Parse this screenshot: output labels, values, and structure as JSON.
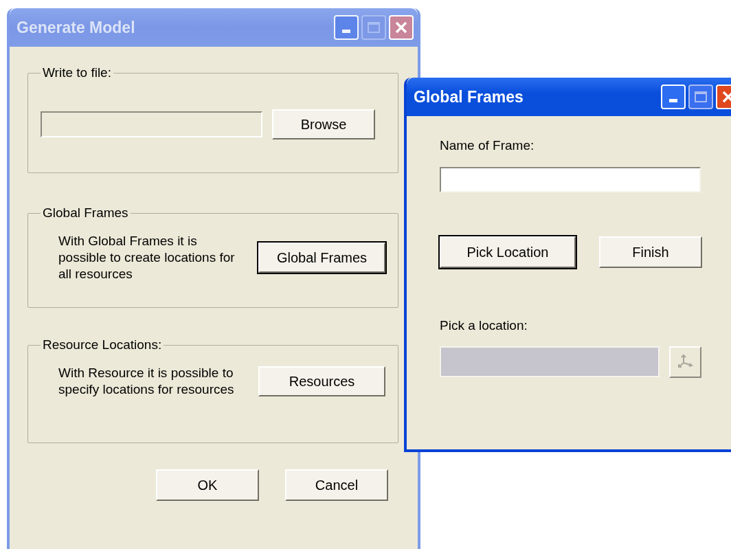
{
  "windows": [
    {
      "title": "Generate Model",
      "active": false,
      "groups": [
        {
          "kind": "file",
          "label": "Write to file:",
          "button": {
            "label": "Browse",
            "default": false
          }
        },
        {
          "kind": "action",
          "label": "Global Frames",
          "description": "With Global Frames it is possible to create locations for all resources",
          "button": {
            "label": "Global Frames",
            "default": true
          }
        },
        {
          "kind": "action",
          "label": "Resource Locations:",
          "description": "With Resource it is possible to specify locations for resources",
          "button": {
            "label": "Resources",
            "default": false
          }
        }
      ],
      "buttons": [
        {
          "label": "OK",
          "default": false
        },
        {
          "label": "Cancel",
          "default": false
        }
      ]
    },
    {
      "title": "Global Frames",
      "active": true,
      "name_label": "Name of Frame:",
      "actions": [
        {
          "label": "Pick Location",
          "default": true
        },
        {
          "label": "Finish",
          "default": false
        }
      ],
      "location_label": "Pick a location:",
      "location_field": {
        "disabled": true
      }
    }
  ]
}
